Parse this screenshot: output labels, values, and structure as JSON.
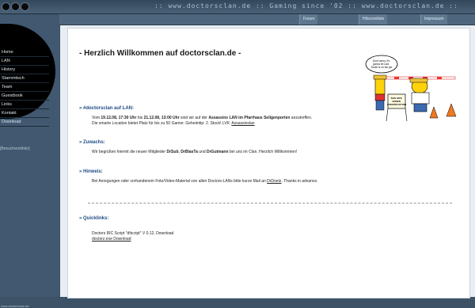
{
  "header": {
    "slogan": ":: www.doctorsclan.de :: Gaming since '02 :: www.doctorsclan.de ::",
    "subnav": [
      "Forum",
      "Hitscoreliste",
      "Impressum"
    ]
  },
  "sidebar": {
    "items": [
      {
        "label": "Home"
      },
      {
        "label": "LAN"
      },
      {
        "label": "History"
      },
      {
        "label": "Stammtisch"
      },
      {
        "label": "Team"
      },
      {
        "label": "Guestbook"
      },
      {
        "label": "Links"
      },
      {
        "label": "Kontakt"
      },
      {
        "label": "Download"
      }
    ],
    "banner_alt": "[Besucherzähler]",
    "footer_url": "www.doctorsclan.de"
  },
  "main": {
    "title": "- Herzlich Willkommen auf doctorsclan.de -",
    "sections": {
      "lan": {
        "heading": "» #doctorsclan auf LAN:",
        "line1_pre": "Vom ",
        "date1": "19.12.08, 17:30 Uhr",
        "line1_mid": " bis ",
        "date2": "21.12.08, 13:00 Uhr",
        "line1_mid2": " sind wir auf der ",
        "event": "Assassins LAN im Pfarrhaus Seligenporten",
        "line1_post": " anzutreffen.",
        "line2": "Die smarte Location bietet Platz für bis zu 50 Gamer. Geheimtip: 2. Stock! LVK: ",
        "link": "Assassinslan"
      },
      "zuwachs": {
        "heading": "» Zuwachs:",
        "pre": "Wir begrüßen hiermit die neuen Mitglieder ",
        "m1": "DrSub",
        "sep1": ", ",
        "m2": "DrBlasTa",
        "sep2": " und ",
        "m3": "DrGutmann",
        "post": " bei uns im Clan. Herzlich Willkommen!"
      },
      "hinweis": {
        "heading": "» Hinweis:",
        "text": "Bei Anregungen oder vorhandenem Foto/Video-Material von allen Doctors-LANs bitte kurze Mail an ",
        "link": "DrDoetz",
        "post": ". Thanks in advance."
      },
      "quicklinks": {
        "heading": "» Quicklinks:",
        "line1": "Doctors IRC Script \"dfscript\" V 0.12, Download",
        "line2": "doctorz.exe Download"
      }
    },
    "cartoon_sign": "THIS SITE UNDER CONSTRUCTION",
    "cartoon_bubble": "Don't worry, it's gonna be cool. Doofe is on the job"
  }
}
